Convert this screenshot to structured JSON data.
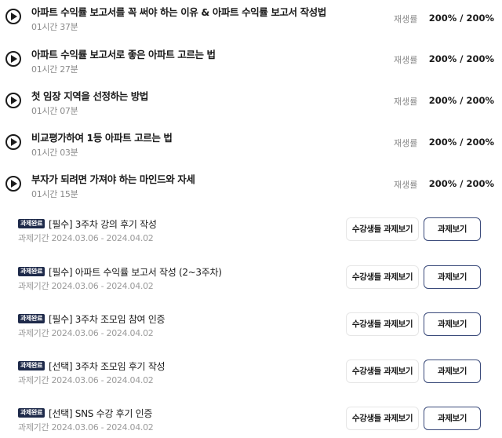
{
  "lectures": [
    {
      "title": "아파트 수익률 보고서를 꼭 써야 하는 이유 & 아파트 수익률 보고서 작성법",
      "duration": "01시간 37분",
      "rate_label": "재생률",
      "rate": "200% / 200%"
    },
    {
      "title": "아파트 수익률 보고서로 좋은 아파트 고르는 법",
      "duration": "01시간 27분",
      "rate_label": "재생률",
      "rate": "200% / 200%"
    },
    {
      "title": "첫 임장 지역을 선정하는 방법",
      "duration": "01시간 07분",
      "rate_label": "재생률",
      "rate": "200% / 200%"
    },
    {
      "title": "비교평가하여 1등 아파트 고르는 법",
      "duration": "01시간 03분",
      "rate_label": "재생률",
      "rate": "200% / 200%"
    },
    {
      "title": "부자가 되려면 가져야 하는 마인드와 자세",
      "duration": "01시간 15분",
      "rate_label": "재생률",
      "rate": "200% / 200%"
    }
  ],
  "assignments": [
    {
      "badge": "과제완료",
      "title": "[필수] 3주차 강의 후기 작성",
      "period": "과제기간 2024.03.06 - 2024.04.02",
      "students_button": "수강생들 과제보기",
      "view_button": "과제보기"
    },
    {
      "badge": "과제완료",
      "title": "[필수] 아파트 수익률 보고서 작성 (2~3주차)",
      "period": "과제기간 2024.03.06 - 2024.04.02",
      "students_button": "수강생들 과제보기",
      "view_button": "과제보기"
    },
    {
      "badge": "과제완료",
      "title": "[필수] 3주차 조모임 참여 인증",
      "period": "과제기간 2024.03.06 - 2024.04.02",
      "students_button": "수강생들 과제보기",
      "view_button": "과제보기"
    },
    {
      "badge": "과제완료",
      "title": "[선택] 3주차 조모임 후기 작성",
      "period": "과제기간 2024.03.06 - 2024.04.02",
      "students_button": "수강생들 과제보기",
      "view_button": "과제보기"
    },
    {
      "badge": "과제완료",
      "title": "[선택] SNS 수강 후기 인증",
      "period": "과제기간 2024.03.06 - 2024.04.02",
      "students_button": "수강생들 과제보기",
      "view_button": "과제보기"
    }
  ],
  "icons": {
    "play": "play-circle-icon"
  },
  "colors": {
    "badge_bg": "#1e2a4a",
    "view_button_border": "#3a4a7a",
    "muted_text": "#8a8a8a"
  }
}
